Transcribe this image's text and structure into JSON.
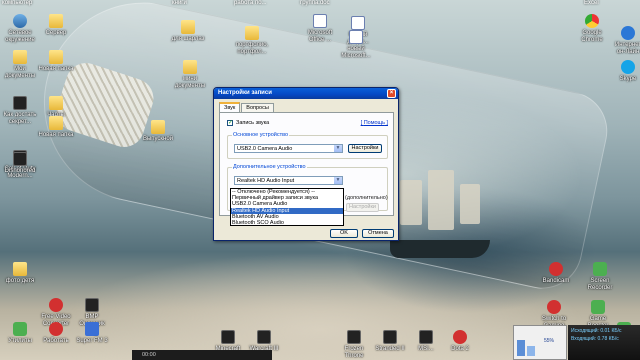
{
  "top_labels": [
    "компьютер",
    "книги",
    "работа по...",
    "группа.doc",
    "Excel"
  ],
  "desktop_left": [
    {
      "id": "network",
      "label": "Сетевое окружение",
      "icon": "network-icon",
      "kind": "net"
    },
    {
      "id": "server",
      "label": "Сервер",
      "icon": "folder-icon",
      "kind": "folder"
    },
    {
      "id": "docs",
      "label": "Мои документы",
      "icon": "my-documents-icon",
      "kind": "folder"
    },
    {
      "id": "newfolder1",
      "label": "Новая папка",
      "icon": "folder-icon",
      "kind": "folder"
    },
    {
      "id": "howto",
      "label": "Как достать секрет...",
      "icon": "game-icon",
      "kind": "game"
    },
    {
      "id": "charts",
      "label": "Чарты",
      "icon": "folder-icon",
      "kind": "folder"
    },
    {
      "id": "cod",
      "label": "Call of Duty Modern...",
      "icon": "game-icon",
      "kind": "game"
    },
    {
      "id": "newfolder2",
      "label": "Новая папка",
      "icon": "folder-icon",
      "kind": "folder"
    },
    {
      "id": "dishonored",
      "label": "Dishonored",
      "icon": "game-icon",
      "kind": "game"
    },
    {
      "id": "photo",
      "label": "фото детя",
      "icon": "folder-icon",
      "kind": "folder"
    },
    {
      "id": "media",
      "label": "Free Video Converter",
      "icon": "converter-icon",
      "kind": "red"
    },
    {
      "id": "bmp",
      "label": "BMP Оценщик",
      "icon": "app-icon",
      "kind": "game"
    },
    {
      "id": "utorrent",
      "label": "Утилиты",
      "icon": "utorrent-icon",
      "kind": "green"
    },
    {
      "id": "rabotat",
      "label": "Работать",
      "icon": "app-icon",
      "kind": "red"
    },
    {
      "id": "superfm",
      "label": "Super FM 3",
      "icon": "app-icon",
      "kind": "blue"
    }
  ],
  "desktop_mid": [
    {
      "id": "for-share",
      "label": "для шарлаз",
      "icon": "folder-icon",
      "kind": "folder"
    },
    {
      "id": "portfolio",
      "label": "портфолио, портфол...",
      "icon": "folder-icon",
      "kind": "folder"
    },
    {
      "id": "msoffice",
      "label": "Microsoft Office ...",
      "icon": "office-icon",
      "kind": "word"
    },
    {
      "id": "newmsword",
      "label": "Новый докум...",
      "icon": "word-icon",
      "kind": "word"
    },
    {
      "id": "newdoc",
      "label": "новый Microsoft...",
      "icon": "word-icon",
      "kind": "word"
    },
    {
      "id": "nashe",
      "label": "мини документы",
      "icon": "folder-icon",
      "kind": "folder"
    },
    {
      "id": "dop",
      "label": "Выпускной",
      "icon": "folder-icon",
      "kind": "folder"
    }
  ],
  "desktop_right": [
    {
      "id": "chrome",
      "label": "Google Chrome",
      "icon": "chrome-icon",
      "kind": "chrome"
    },
    {
      "id": "ie",
      "label": "Интернет он-Лайн",
      "icon": "ie-icon",
      "kind": "ie"
    },
    {
      "id": "skype",
      "label": "Skype",
      "icon": "skype-icon",
      "kind": "skype"
    },
    {
      "id": "bandicam",
      "label": "Bandicam",
      "icon": "bandicam-icon",
      "kind": "red"
    },
    {
      "id": "screenrec",
      "label": "Screen Recorder",
      "icon": "recorder-icon",
      "kind": "green"
    },
    {
      "id": "gaming",
      "label": "Switch to Gaming Mode",
      "icon": "gaming-icon",
      "kind": "red"
    },
    {
      "id": "gamebooster",
      "label": "Game Booster",
      "icon": "booster-icon",
      "kind": "green"
    },
    {
      "id": "utorrent2",
      "label": "µTorrent",
      "icon": "utorrent-icon",
      "kind": "green"
    }
  ],
  "taskbar_bottom": [
    {
      "id": "mc",
      "label": "Minecraft",
      "icon": "minecraft-icon",
      "kind": "game"
    },
    {
      "id": "warcraft",
      "label": "Warcraft III",
      "icon": "warcraft-icon",
      "kind": "game"
    },
    {
      "id": "frozen",
      "label": "Frozen Throne",
      "icon": "frozen-icon",
      "kind": "game"
    },
    {
      "id": "stranded",
      "label": "Stranded II",
      "icon": "stranded-icon",
      "kind": "game"
    },
    {
      "id": "msi",
      "label": "MSI...",
      "icon": "msi-icon",
      "kind": "game"
    },
    {
      "id": "dota",
      "label": "Dota 2",
      "icon": "dota-icon",
      "kind": "red"
    }
  ],
  "dialog": {
    "title": "Настройки записи",
    "tabs": [
      "Звук",
      "Вопросы"
    ],
    "checkbox_label": "Запись звука",
    "help_link": "Помощь",
    "primary_group": "Основное устройство",
    "primary_device": "USB2.0 Camera Audio",
    "settings_button": "Настройки",
    "secondary_group": "Дополнительное устройство",
    "secondary_device": "Realtek HD Audio Input",
    "ok_button": "OK",
    "cancel_button": "Отмена",
    "hint_text": "(дополнительно)",
    "dropdown_options": [
      "-- Отключено (Рекомендуется) --",
      "Первичный драйвер записи звука",
      "USB2.0 Camera Audio",
      "Realtek HD Audio Input",
      "Bluetooth AV Audio",
      "Bluetooth SCO Audio"
    ],
    "selected_index": 3
  },
  "taskbar_strip_text": "00:00",
  "perf": {
    "cpu": "55%"
  },
  "netmeter": {
    "upload_label": "Исходящий:",
    "upload_value": "0.01 КБ/с",
    "download_label": "Входящий:",
    "download_value": "0.78 КБ/с"
  }
}
